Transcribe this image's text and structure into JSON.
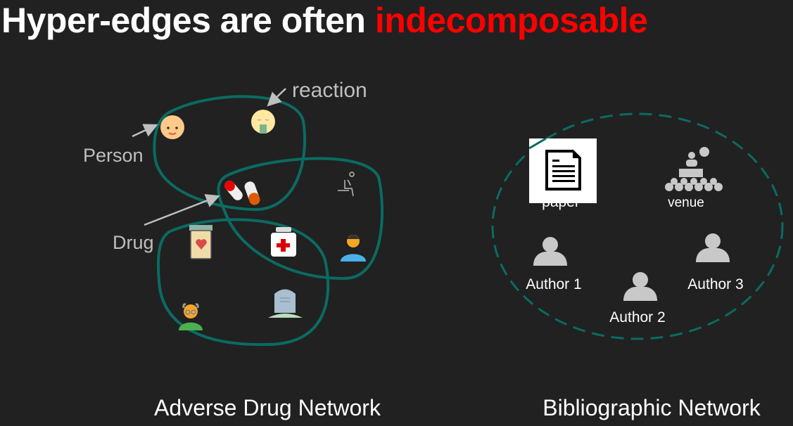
{
  "title": {
    "prefix": "Hyper-edges are often ",
    "highlight": "indecomposable"
  },
  "colors": {
    "background": "#212121",
    "highlight": "#ff0000",
    "hyperedge": "#0b6b62",
    "label": "#bfbfbf"
  },
  "adverse_drug": {
    "labels": {
      "reaction": "reaction",
      "person": "Person",
      "drug": "Drug"
    },
    "icons": [
      "baby-icon",
      "sick-face-icon",
      "pills-icon",
      "sitting-person-icon",
      "medicine-jar-icon",
      "medicine-bottle-icon",
      "man-icon",
      "old-man-icon",
      "tombstone-icon"
    ],
    "caption": "Adverse Drug Network"
  },
  "bibliographic": {
    "paper": "paper",
    "venue": "venue",
    "authors": [
      "Author 1",
      "Author 2",
      "Author 3"
    ],
    "caption": "Bibliographic Network"
  }
}
